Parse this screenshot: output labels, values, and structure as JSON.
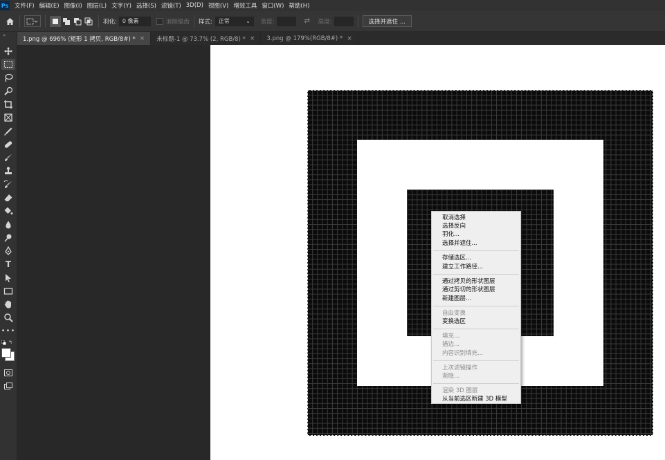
{
  "app_badge": "Ps",
  "menu": [
    "文件(F)",
    "编辑(E)",
    "图像(I)",
    "图层(L)",
    "文字(Y)",
    "选择(S)",
    "滤镜(T)",
    "3D(D)",
    "视图(V)",
    "增效工具",
    "窗口(W)",
    "帮助(H)"
  ],
  "options": {
    "feather_label": "羽化:",
    "feather_value": "0 像素",
    "antialias_label": "消除锯齿",
    "style_label": "样式:",
    "style_value": "正常",
    "width_label": "宽度:",
    "height_label": "高度:",
    "select_mask_button": "选择并遮住 ..."
  },
  "tabs": [
    {
      "label": "1.png @ 696% (矩形 1 拷贝, RGB/8#) *",
      "active": true
    },
    {
      "label": "未标题-1 @ 73.7% (2, RGB/8) *",
      "active": false
    },
    {
      "label": "3.png @ 179%(RGB/8#) *",
      "active": false
    }
  ],
  "context_menu": {
    "items": [
      {
        "label": "取消选择",
        "disabled": false
      },
      {
        "label": "选择反向",
        "disabled": false
      },
      {
        "label": "羽化...",
        "disabled": false
      },
      {
        "label": "选择并遮住...",
        "disabled": false
      },
      {
        "label": "存储选区...",
        "disabled": false
      },
      {
        "label": "建立工作路径...",
        "disabled": false
      },
      {
        "label": "通过拷贝的形状图层",
        "disabled": false
      },
      {
        "label": "通过剪切的形状图层",
        "disabled": false
      },
      {
        "label": "新建图层...",
        "disabled": false
      },
      {
        "label": "自由变换",
        "disabled": true
      },
      {
        "label": "变换选区",
        "disabled": false
      },
      {
        "label": "填充...",
        "disabled": true
      },
      {
        "label": "描边...",
        "disabled": true
      },
      {
        "label": "内容识别填充...",
        "disabled": true
      },
      {
        "label": "上次滤镜操作",
        "disabled": true
      },
      {
        "label": "渐隐...",
        "disabled": true
      },
      {
        "label": "渲染 3D 图层",
        "disabled": true
      },
      {
        "label": "从当前选区新建 3D 模型",
        "disabled": false
      }
    ]
  },
  "tools": [
    "move-icon",
    "rect-marquee-icon",
    "lasso-icon",
    "quick-select-icon",
    "crop-icon",
    "frame-icon",
    "eyedropper-icon",
    "healing-brush-icon",
    "brush-icon",
    "clone-stamp-icon",
    "history-brush-icon",
    "eraser-icon",
    "paint-bucket-icon",
    "blur-icon",
    "dodge-icon",
    "pen-icon",
    "type-icon",
    "path-select-icon",
    "rectangle-icon",
    "hand-icon",
    "zoom-icon",
    "more-tools-icon"
  ],
  "colors": {
    "foreground": "#ffffff",
    "background": "#ffffff",
    "accent": "#31a8ff"
  }
}
